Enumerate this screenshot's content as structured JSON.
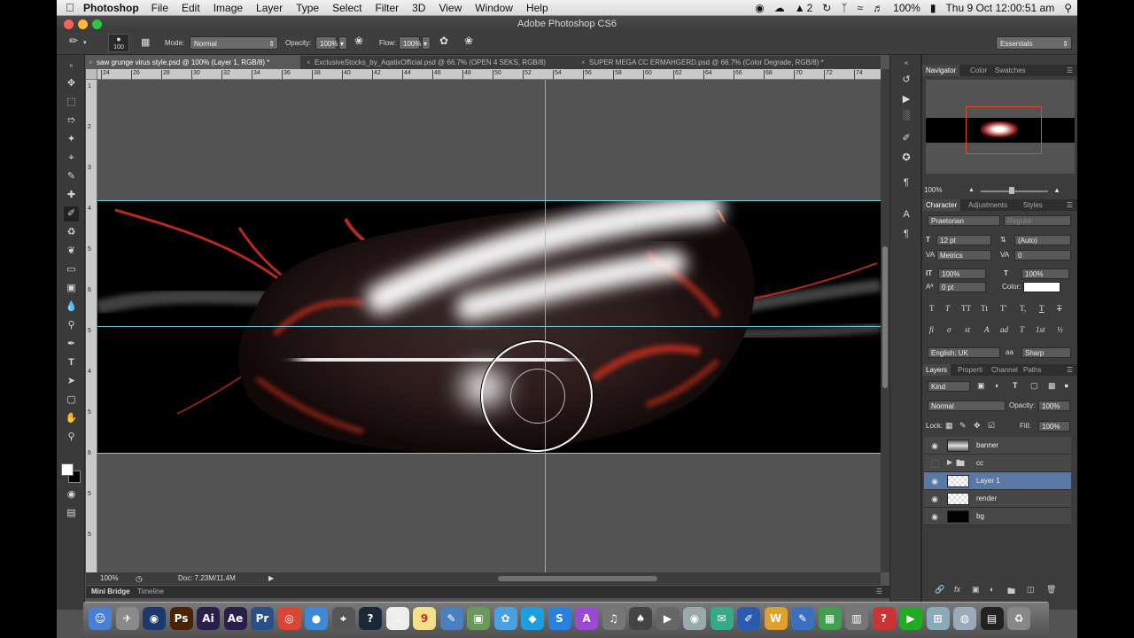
{
  "menubar": {
    "app_name": "Photoshop",
    "items": [
      "File",
      "Edit",
      "Image",
      "Layer",
      "Type",
      "Select",
      "Filter",
      "3D",
      "View",
      "Window",
      "Help"
    ],
    "status_a2": "2",
    "battery": "100%",
    "clock": "Thu 9 Oct  12:00:51 am"
  },
  "window": {
    "title": "Adobe Photoshop CS6"
  },
  "options": {
    "brush_size": "100",
    "mode_label": "Mode:",
    "mode_value": "Normal",
    "opacity_label": "Opacity:",
    "opacity_value": "100%",
    "flow_label": "Flow:",
    "flow_value": "100%",
    "workspace": "Essentials"
  },
  "tabs": [
    {
      "label": "saw grunge virus style.psd @ 100% (Layer 1, RGB/8) *"
    },
    {
      "label": "ExclusiveStocks_by_AqatixOfficial.psd @ 66.7% (OPEN 4 SEKS, RGB/8)"
    },
    {
      "label": "SUPER MEGA CC ERMAHGERD.psd @ 66.7% (Color Degrade, RGB/8) *"
    }
  ],
  "ruler": {
    "top_ticks": [
      "24",
      "26",
      "28",
      "30",
      "32",
      "34",
      "36",
      "38",
      "40",
      "42",
      "44",
      "46",
      "48",
      "50",
      "52",
      "54",
      "56",
      "58",
      "60",
      "62",
      "64",
      "66",
      "68",
      "70",
      "72",
      "74"
    ],
    "left_ticks": [
      "1",
      "2",
      "3",
      "4",
      "5",
      "6",
      "5",
      "4",
      "5",
      "6",
      "5",
      "5"
    ]
  },
  "status": {
    "zoom": "100%",
    "doc": "Doc: 7.23M/11.4M"
  },
  "bottom_tabs": [
    "Mini Bridge",
    "Timeline"
  ],
  "navigator": {
    "tabs": [
      "Navigator",
      "Color",
      "Swatches"
    ],
    "zoom": "100%"
  },
  "character": {
    "tabs": [
      "Character",
      "Adjustments",
      "Styles"
    ],
    "font_family": "Praetorian",
    "font_style": "Regular",
    "size": "12 pt",
    "leading": "(Auto)",
    "kerning": "Metrics",
    "tracking": "0",
    "vscale": "100%",
    "hscale": "100%",
    "baseline": "0 pt",
    "color_label": "Color:",
    "language": "English: UK",
    "antialias": "Sharp",
    "style_buttons": [
      "T",
      "T",
      "TT",
      "Tt",
      "T'",
      "T,",
      "T",
      "T"
    ],
    "ot_buttons": [
      "fi",
      "σ",
      "st",
      "A",
      "ad",
      "T",
      "1st",
      "½"
    ]
  },
  "layers": {
    "tabs": [
      "Layers",
      "Properti",
      "Channel",
      "Paths"
    ],
    "kind": "Kind",
    "blend": "Normal",
    "opacity_label": "Opacity:",
    "opacity": "100%",
    "lock_label": "Lock:",
    "fill_label": "Fill:",
    "fill": "100%",
    "items": [
      {
        "name": "banner",
        "visible": true
      },
      {
        "name": "cc",
        "visible": false
      },
      {
        "name": "Layer 1",
        "visible": true
      },
      {
        "name": "render",
        "visible": true
      },
      {
        "name": "bg",
        "visible": true
      }
    ]
  },
  "dock": {
    "apps": [
      "Finder",
      "Launchpad",
      "Photoshop",
      "Illustrator",
      "After Effects",
      "Premiere",
      "Cinema 4D",
      "Chrome",
      "Safari",
      "Help",
      "Steam",
      "Calendar",
      "Notes",
      "Preview",
      "Photos",
      "Messages",
      "Skype",
      "App Store",
      "iTunes",
      "Games",
      "Movies",
      "Photo Booth",
      "Mail",
      "Text Edit",
      "Word",
      "Pages",
      "Keynote",
      "Numbers",
      "Help",
      "Camera",
      "Play",
      "Disk",
      "Network",
      "Terminal",
      "Trash"
    ],
    "calendar_day": "9"
  },
  "colors": {
    "accent_guide": "#5fd6f0",
    "selected_layer": "#5a78a5",
    "nav_box": "#e04a2a"
  }
}
